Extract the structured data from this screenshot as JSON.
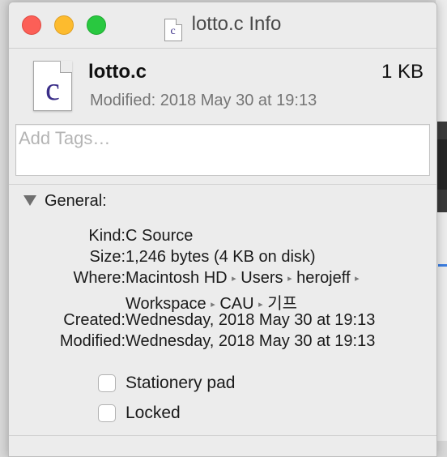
{
  "window": {
    "title": "lotto.c Info",
    "title_icon": "c-source-document-icon",
    "title_icon_letter": "c"
  },
  "header": {
    "icon_letter": "c",
    "file_name": "lotto.c",
    "file_size": "1 KB",
    "modified_summary": "Modified: 2018 May 30 at 19:13"
  },
  "tags": {
    "placeholder": "Add Tags…"
  },
  "general": {
    "title": "General:",
    "kind_label": "Kind:",
    "kind_value": "C Source",
    "size_label": "Size:",
    "size_value": "1,246 bytes (4 KB on disk)",
    "where_label": "Where:",
    "where_path_line1": [
      "Macintosh HD",
      "Users",
      "herojeff"
    ],
    "where_path_line2": [
      "Workspace",
      "CAU",
      "기프"
    ],
    "path_separator": "▸",
    "created_label": "Created:",
    "created_value": "Wednesday, 2018 May 30 at 19:13",
    "modified_label": "Modified:",
    "modified_value": "Wednesday, 2018 May 30 at 19:13"
  },
  "options": {
    "stationery_label": "Stationery pad",
    "stationery_checked": false,
    "locked_label": "Locked",
    "locked_checked": false
  },
  "colors": {
    "window_bg": "#ececec",
    "close": "#fc5f57",
    "minimize": "#fdbb2e",
    "zoom": "#29c840",
    "icon_letter": "#3a2e88"
  }
}
